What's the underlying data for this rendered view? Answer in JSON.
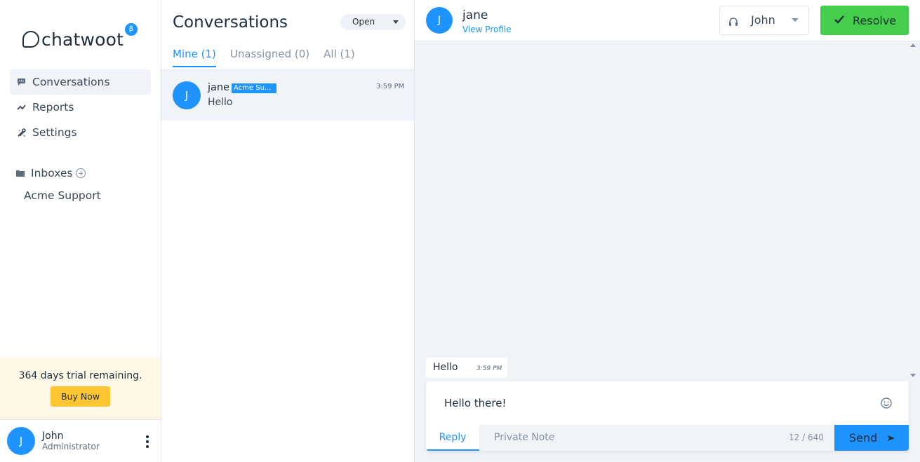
{
  "app": {
    "brand": "chatwoot",
    "beta_badge": "β"
  },
  "sidebar": {
    "nav": [
      {
        "label": "Conversations",
        "icon": "chat-bubble-icon"
      },
      {
        "label": "Reports",
        "icon": "trend-icon"
      },
      {
        "label": "Settings",
        "icon": "tools-icon"
      }
    ],
    "inboxes_label": "Inboxes",
    "inboxes": [
      {
        "label": "Acme Support"
      }
    ],
    "trial_text": "364 days trial remaining.",
    "buy_label": "Buy Now",
    "user": {
      "initial": "J",
      "name": "John",
      "role": "Administrator"
    }
  },
  "conversation_list": {
    "title": "Conversations",
    "status_filter": "Open",
    "tabs": [
      {
        "label": "Mine (1)"
      },
      {
        "label": "Unassigned (0)"
      },
      {
        "label": "All (1)"
      }
    ],
    "items": [
      {
        "initial": "J",
        "name": "jane",
        "inbox_badge": "Acme Su...",
        "time": "3:59 PM",
        "last_message": "Hello"
      }
    ]
  },
  "chat": {
    "contact": {
      "initial": "J",
      "name": "jane",
      "view_profile": "View Profile"
    },
    "assignee": "John",
    "resolve_label": "Resolve",
    "messages": [
      {
        "text": "Hello",
        "time": "3:59 PM"
      }
    ],
    "reply": {
      "draft": "Hello there!",
      "mode_reply": "Reply",
      "mode_note": "Private Note",
      "char_count": "12 / 640",
      "send_label": "Send"
    }
  },
  "colors": {
    "accent": "#1f93ff",
    "success": "#44ce4b",
    "warning": "#ffc532",
    "trial_bg": "#fff8e6",
    "panel_bg": "#f0f4f8"
  }
}
